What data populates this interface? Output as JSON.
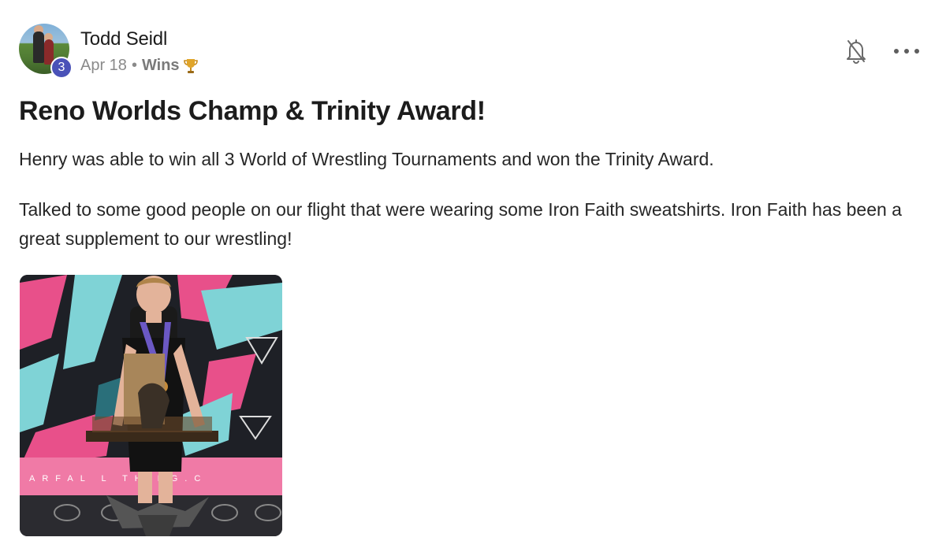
{
  "author": {
    "name": "Todd Seidl",
    "level": "3"
  },
  "meta": {
    "date": "Apr 18",
    "separator": "•",
    "category": "Wins",
    "category_icon": "trophy-icon"
  },
  "actions": {
    "notify_icon": "bell-icon",
    "more_icon": "more-horizontal-icon"
  },
  "post": {
    "title": "Reno Worlds Champ & Trinity Award!",
    "paragraphs": [
      "Henry was able to win all 3 World of Wrestling Tournaments and won the Trinity Award.",
      "Talked to some good people on our flight that were wearing some Iron Faith sweatshirts. Iron Faith has been a great supplement to our wrestling!"
    ]
  },
  "photo_banner_text": "ARFAL  L  THING.C",
  "colors": {
    "badge": "#4a52b8",
    "backdrop_pink": "#e8508a",
    "backdrop_teal": "#7fd3d6"
  }
}
